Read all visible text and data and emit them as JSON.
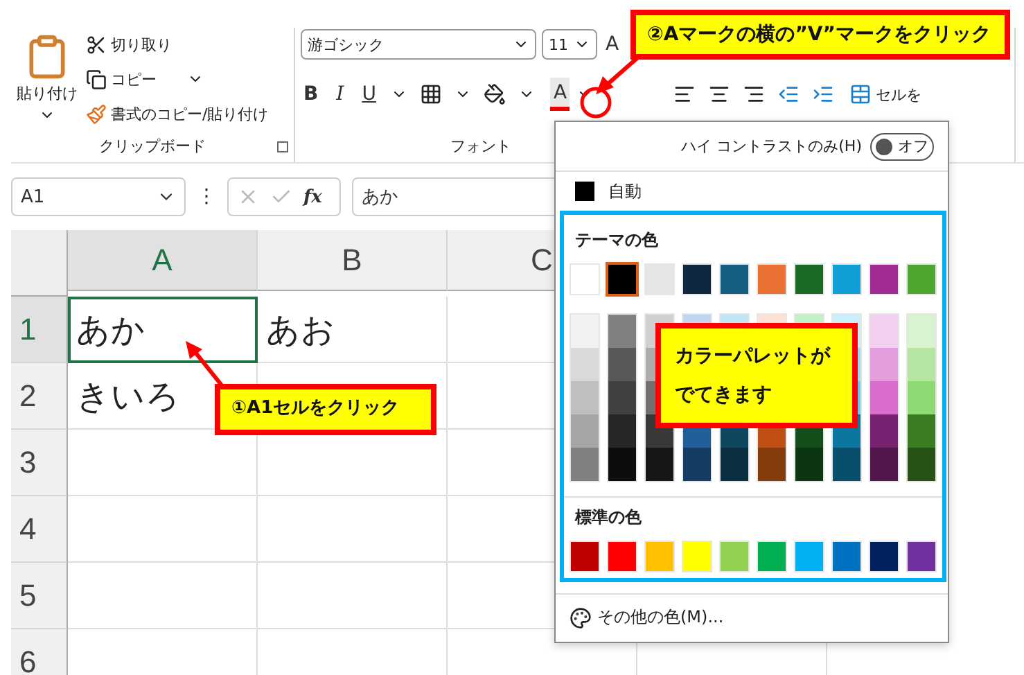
{
  "ribbon": {
    "clipboard": {
      "paste": "貼り付け",
      "cut": "切り取り",
      "copy": "コピー",
      "format_painter": "書式のコピー/貼り付け",
      "group_label": "クリップボード"
    },
    "font": {
      "font_name": "游ゴシック",
      "font_size": "11",
      "grow_font": "A",
      "bold": "B",
      "italic": "I",
      "underline": "U",
      "color_letter": "A",
      "group_label": "フォント"
    },
    "merge_cell": "セルを"
  },
  "formula_bar": {
    "name_box": "A1",
    "more": "⋮",
    "fx": "fx",
    "value": "あか"
  },
  "sheet": {
    "columns": [
      {
        "label": "A",
        "selected": true
      },
      {
        "label": "B",
        "selected": false
      },
      {
        "label": "C",
        "selected": false
      }
    ],
    "rows": [
      {
        "label": "1",
        "selected": true,
        "cells": [
          {
            "text": "あか",
            "selected": true
          },
          {
            "text": "あお",
            "selected": false
          },
          {
            "text": "",
            "selected": false
          }
        ]
      },
      {
        "label": "2",
        "selected": false,
        "cells": [
          {
            "text": "きいろ",
            "selected": false
          },
          {
            "text": "",
            "selected": false
          },
          {
            "text": "",
            "selected": false
          }
        ]
      },
      {
        "label": "3",
        "selected": false,
        "cells": []
      },
      {
        "label": "4",
        "selected": false,
        "cells": []
      },
      {
        "label": "5",
        "selected": false,
        "cells": []
      },
      {
        "label": "6",
        "selected": false,
        "cells": []
      }
    ]
  },
  "color_menu": {
    "high_contrast": {
      "label": "ハイ コントラストのみ(H)",
      "on": false,
      "state_text": "オフ"
    },
    "automatic": "自動",
    "theme_title": "テーマの色",
    "theme_colors": [
      {
        "color": "#ffffff",
        "selected": false
      },
      {
        "color": "#000000",
        "selected": true
      },
      {
        "color": "#e7e6e6",
        "selected": false
      },
      {
        "color": "#0e2841",
        "selected": false
      },
      {
        "color": "#156082",
        "selected": false
      },
      {
        "color": "#e97132",
        "selected": false
      },
      {
        "color": "#196b24",
        "selected": false
      },
      {
        "color": "#0f9ed5",
        "selected": false
      },
      {
        "color": "#a02b93",
        "selected": false
      },
      {
        "color": "#4ea72e",
        "selected": false
      }
    ],
    "shades": [
      {
        "colors": [
          {
            "color": "#f2f2f2"
          },
          {
            "color": "#d9d9d9"
          },
          {
            "color": "#bfbfbf"
          },
          {
            "color": "#a6a6a6"
          },
          {
            "color": "#808080"
          }
        ]
      },
      {
        "colors": [
          {
            "color": "#808080"
          },
          {
            "color": "#595959"
          },
          {
            "color": "#404040"
          },
          {
            "color": "#262626"
          },
          {
            "color": "#0d0d0d"
          }
        ]
      },
      {
        "colors": [
          {
            "color": "#d0d0d0"
          },
          {
            "color": "#aeabab"
          },
          {
            "color": "#757070"
          },
          {
            "color": "#3a3838"
          },
          {
            "color": "#171616"
          }
        ]
      },
      {
        "colors": [
          {
            "color": "#c0d5ef"
          }
        ],
        "below_callout": [
          {
            "color": "#215f9a"
          },
          {
            "color": "#153d64"
          }
        ]
      },
      {
        "colors": [
          {
            "color": "#c1e5f5"
          }
        ],
        "below_callout": [
          {
            "color": "#0f4761"
          },
          {
            "color": "#0a2f40"
          }
        ]
      },
      {
        "colors": [
          {
            "color": "#fbe2d5"
          }
        ],
        "below_callout": [
          {
            "color": "#c04f15"
          },
          {
            "color": "#843c0c"
          }
        ]
      },
      {
        "colors": [
          {
            "color": "#c2f1c8"
          }
        ],
        "below_callout": [
          {
            "color": "#124f1a"
          },
          {
            "color": "#0c3512"
          }
        ]
      },
      {
        "colors": [
          {
            "color": "#caeefb"
          },
          {
            "color": "#95dcf7"
          },
          {
            "color": "#61cbf3"
          },
          {
            "color": "#0b76a0"
          },
          {
            "color": "#074f6a"
          }
        ]
      },
      {
        "colors": [
          {
            "color": "#f2ceef"
          },
          {
            "color": "#e49edd"
          },
          {
            "color": "#d86dcd"
          },
          {
            "color": "#782170"
          },
          {
            "color": "#51164b"
          }
        ]
      },
      {
        "colors": [
          {
            "color": "#d9f2d0"
          },
          {
            "color": "#b4e5a2"
          },
          {
            "color": "#8ed973"
          },
          {
            "color": "#3a7d22"
          },
          {
            "color": "#275317"
          }
        ]
      }
    ],
    "standard_title": "標準の色",
    "standard_colors": [
      {
        "color": "#c00000"
      },
      {
        "color": "#ff0000"
      },
      {
        "color": "#ffc000"
      },
      {
        "color": "#ffff00"
      },
      {
        "color": "#92d050"
      },
      {
        "color": "#00b050"
      },
      {
        "color": "#00b0f0"
      },
      {
        "color": "#0070c0"
      },
      {
        "color": "#002060"
      },
      {
        "color": "#7030a0"
      }
    ],
    "more_colors": "その他の色(M)..."
  },
  "callouts": [
    {
      "text": "①A1セルをクリック"
    },
    {
      "text": "②Aマークの横の”V”マークをクリック"
    },
    {
      "text": "カラーパレットがでてきます"
    }
  ]
}
